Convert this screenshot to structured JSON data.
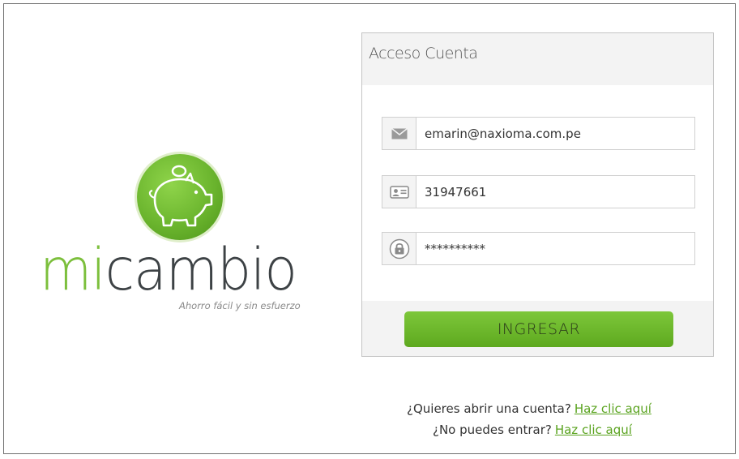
{
  "logo": {
    "wordmark_accent": "mi",
    "wordmark_rest": "cambio",
    "tagline": "Ahorro fácil y sin esfuerzo",
    "icon": "piggy-bank-icon",
    "colors": {
      "green": "#7cbf3c",
      "dark": "#3d4245"
    }
  },
  "login": {
    "title": "Acceso Cuenta",
    "email": {
      "icon": "envelope-icon",
      "value": "emarin@naxioma.com.pe"
    },
    "id_number": {
      "icon": "id-card-icon",
      "value": "31947661"
    },
    "password": {
      "icon": "lock-icon",
      "value": "**********"
    },
    "submit_label": "INGRESAR",
    "accent": "#6bb52e"
  },
  "help": {
    "open_account_text": "¿Quieres abrir una cuenta?",
    "open_account_link": "Haz clic aquí",
    "cant_login_text": "¿No puedes entrar?",
    "cant_login_link": "Haz clic aquí"
  }
}
